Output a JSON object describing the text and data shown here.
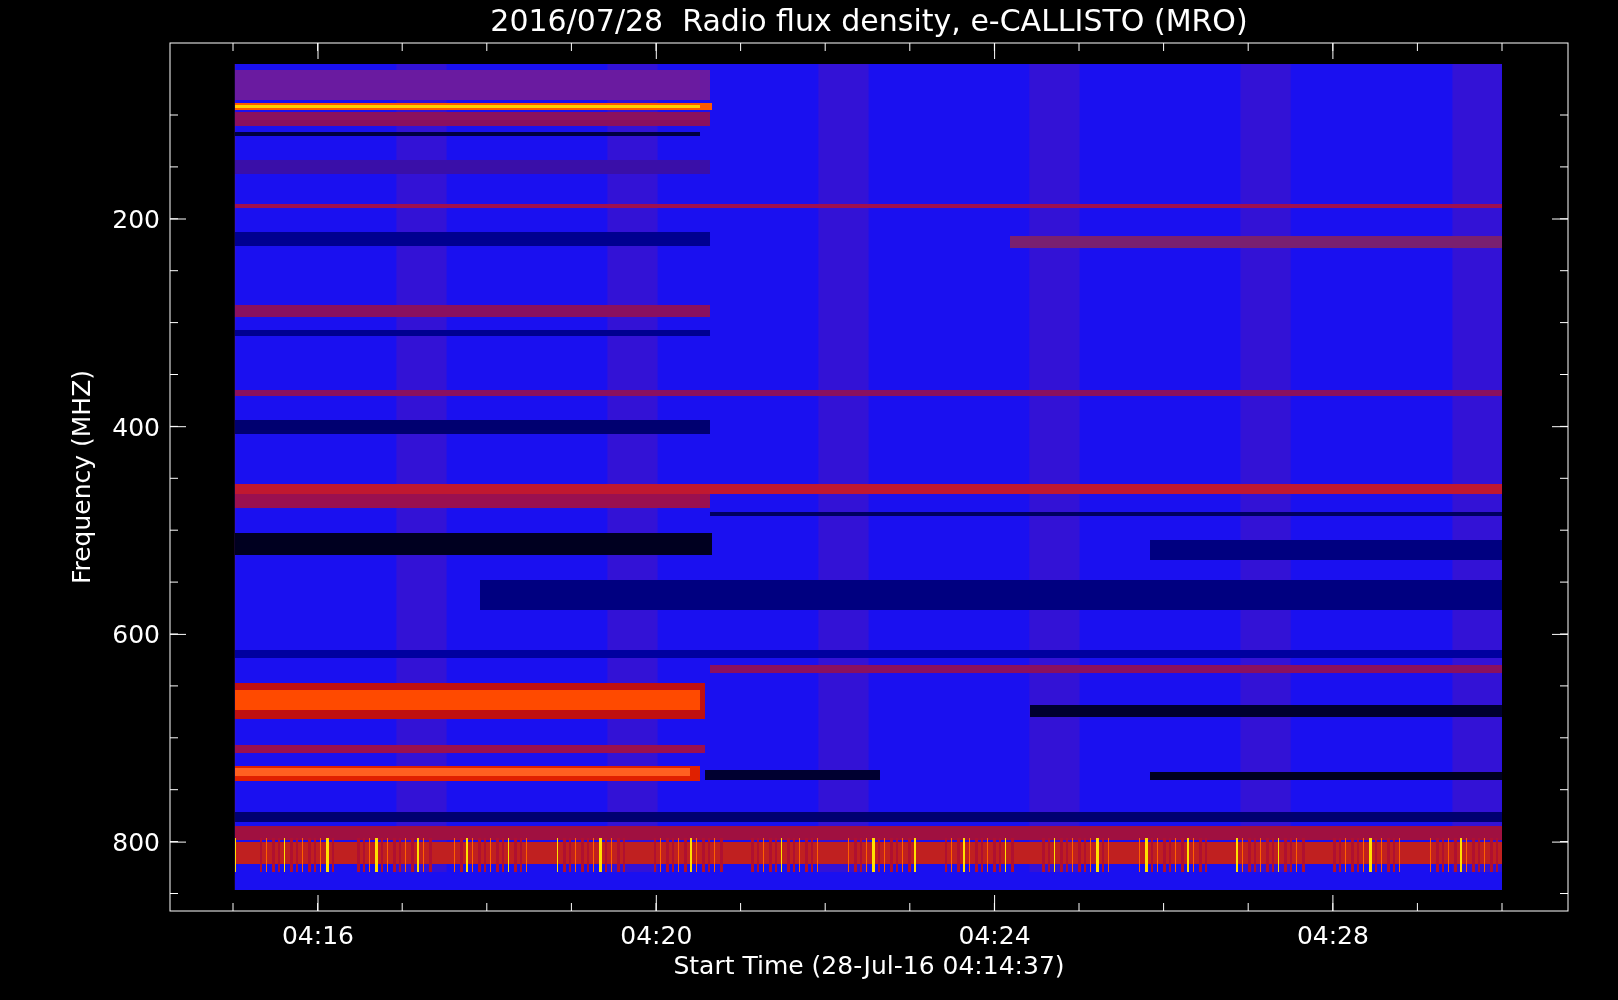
{
  "title": "2016/07/28  Radio flux density, e-CALLISTO (MRO)",
  "y_axis": {
    "label": "Frequency (MHZ)",
    "ticks": [
      "200",
      "400",
      "600",
      "800"
    ]
  },
  "x_axis": {
    "label": "Start Time (28-Jul-16 04:14:37)",
    "ticks": [
      "04:16",
      "04:20",
      "04:24",
      "04:28"
    ]
  }
}
